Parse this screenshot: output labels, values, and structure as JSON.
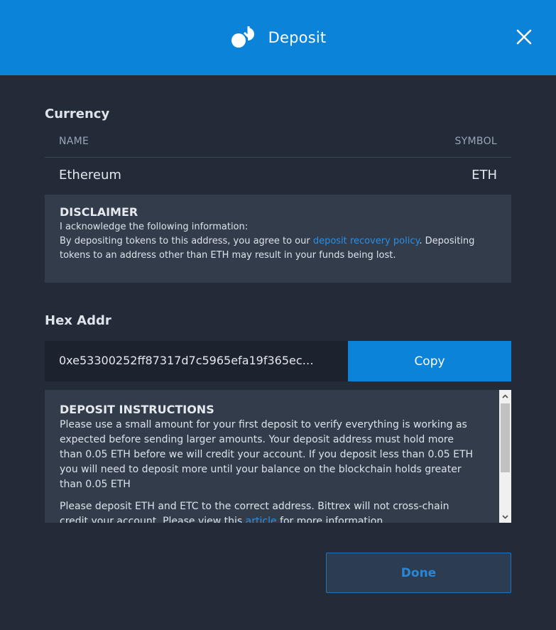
{
  "header": {
    "title": "Deposit"
  },
  "currency": {
    "section_label": "Currency",
    "columns": {
      "name": "NAME",
      "symbol": "SYMBOL"
    },
    "row": {
      "name": "Ethereum",
      "symbol": "ETH"
    }
  },
  "disclaimer": {
    "title": "DISCLAIMER",
    "line1": "I acknowledge the following information:",
    "line2_before": "By depositing tokens to this address, you agree to our ",
    "line2_link": "deposit recovery policy",
    "line2_after": ". Depositing tokens to an address other than ETH may result in your funds being lost."
  },
  "address": {
    "section_label": "Hex Addr",
    "value": "0xe53300252ff87317d7c5965efa19f365ec…",
    "copy_label": "Copy"
  },
  "instructions": {
    "title": "DEPOSIT INSTRUCTIONS",
    "para1": "Please use a small amount for your first deposit to verify everything is working as expected before sending larger amounts. Your deposit address must hold more than 0.05 ETH before we will credit your account. If you deposit less than 0.05 ETH you will need to deposit more until your balance on the blockchain holds greater than 0.05 ETH",
    "para2_before": "Please deposit ETH and ETC to the correct address. Bittrex will not cross-chain credit your account. Please view this ",
    "para2_link": "article",
    "para2_after": " for more information."
  },
  "footer": {
    "done_label": "Done"
  },
  "colors": {
    "header_bg": "#0b83d9",
    "body_bg": "#232b38",
    "panel_bg": "#323c4b",
    "accent": "#0b83d9",
    "link": "#2d8fe0"
  }
}
